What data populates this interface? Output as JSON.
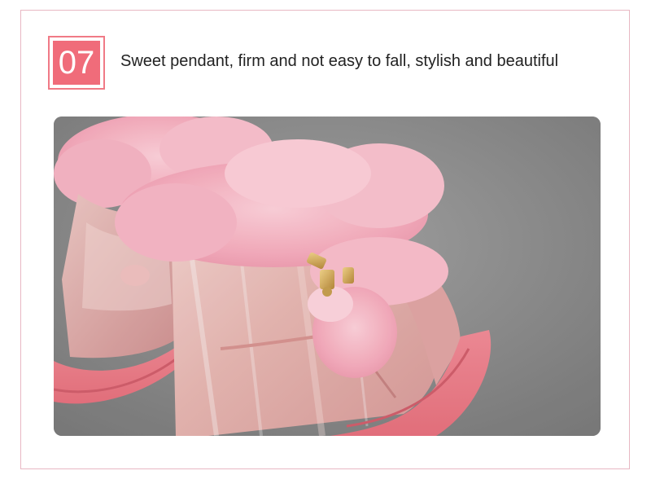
{
  "badge": {
    "number": "07"
  },
  "caption": {
    "text": "Sweet pendant, firm and not easy to fall, stylish and beautiful"
  },
  "photo": {
    "subject": "pink kids snow boots with fur trim and fur pendant",
    "accent_color": "#f06c7a",
    "border_color": "#e8b7c3"
  }
}
